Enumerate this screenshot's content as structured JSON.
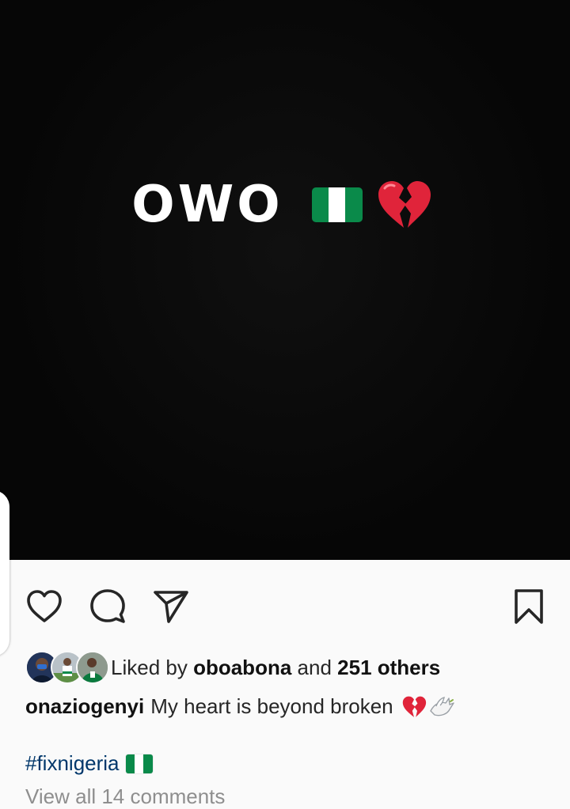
{
  "post": {
    "image_text": "OWO",
    "image_emojis": [
      "nigeria-flag",
      "broken-heart"
    ]
  },
  "actions": {
    "like_icon": "heart-outline-icon",
    "comment_icon": "comment-bubble-icon",
    "share_icon": "paper-plane-icon",
    "save_icon": "bookmark-icon"
  },
  "likes": {
    "prefix": "Liked by",
    "user": "oboabona",
    "connector": "and",
    "others": "251 others"
  },
  "caption": {
    "username": "onaziogenyi",
    "text": "My heart is beyond broken",
    "emojis": [
      "broken-heart",
      "dove"
    ]
  },
  "hashtag": {
    "tag": "#fixnigeria",
    "emoji": "nigeria-flag"
  },
  "comments": {
    "view_all": "View all 14 comments"
  },
  "colors": {
    "flag_green": "#0a8a4a",
    "hashtag_blue": "#00376b",
    "heart_red": "#e0243a"
  }
}
